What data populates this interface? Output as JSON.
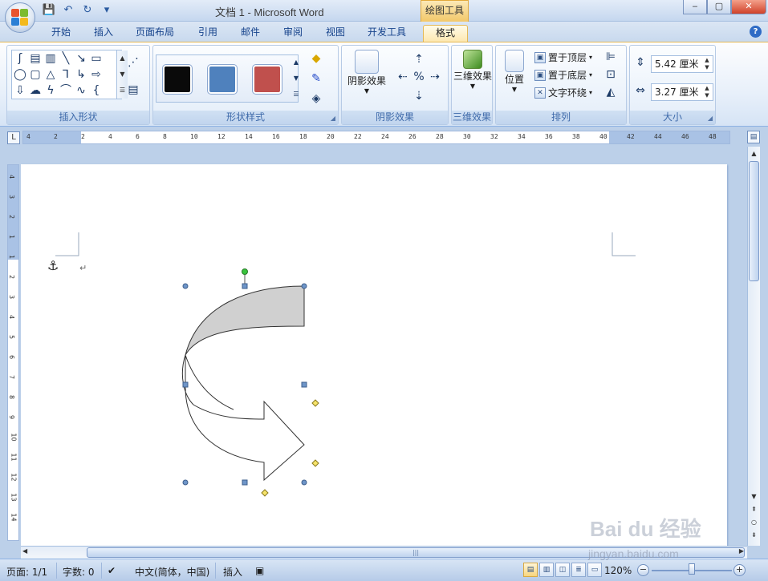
{
  "window": {
    "title": "文档 1 - Microsoft Word",
    "context_tab_title": "绘图工具",
    "controls": [
      "‒",
      "▢",
      "✕"
    ]
  },
  "qat": {
    "save": "💾",
    "undo": "↶",
    "redo": "↻",
    "customize": "▾"
  },
  "tabs": [
    "开始",
    "插入",
    "页面布局",
    "引用",
    "邮件",
    "审阅",
    "视图",
    "开发工具",
    "格式"
  ],
  "active_tab": "格式",
  "ribbon": {
    "groups": {
      "insert_shapes": "插入形状",
      "shape_styles": "形状样式",
      "shadow_effects": "阴影效果",
      "threed": "三维效果",
      "arrange": "排列",
      "size": "大小"
    },
    "shadow_button": "阴影效果",
    "threed_button": "三维效果",
    "position_button": "位置",
    "bring_to_front": "置于顶层",
    "send_to_back": "置于底层",
    "text_wrap": "文字环绕",
    "height_value": "5.42 厘米",
    "width_value": "3.27 厘米",
    "style_colors": [
      "#0a0a0a",
      "#4f81bd",
      "#c0504d"
    ]
  },
  "ruler": {
    "h_labels": [
      "4",
      "2",
      "2",
      "4",
      "6",
      "8",
      "10",
      "12",
      "14",
      "16",
      "18",
      "20",
      "22",
      "24",
      "26",
      "28",
      "30",
      "32",
      "34",
      "36",
      "38",
      "40",
      "42",
      "44",
      "46",
      "48"
    ],
    "v_labels": [
      "4",
      "3",
      "2",
      "1",
      "1",
      "2",
      "3",
      "4",
      "5",
      "6",
      "7",
      "8",
      "9",
      "10",
      "11",
      "12",
      "13",
      "14"
    ]
  },
  "document": {
    "paragraph_mark": "↵",
    "anchor": "⚓",
    "shape": "curved-right-arrow",
    "shape_fill": "#d0d0d0"
  },
  "status": {
    "page": "页面: 1/1",
    "words": "字数: 0",
    "language": "中文(简体，中国)",
    "mode": "插入",
    "zoom": "120%"
  },
  "watermark": {
    "brand": "Bai du 经验",
    "url": "jingyan.baidu.com"
  }
}
